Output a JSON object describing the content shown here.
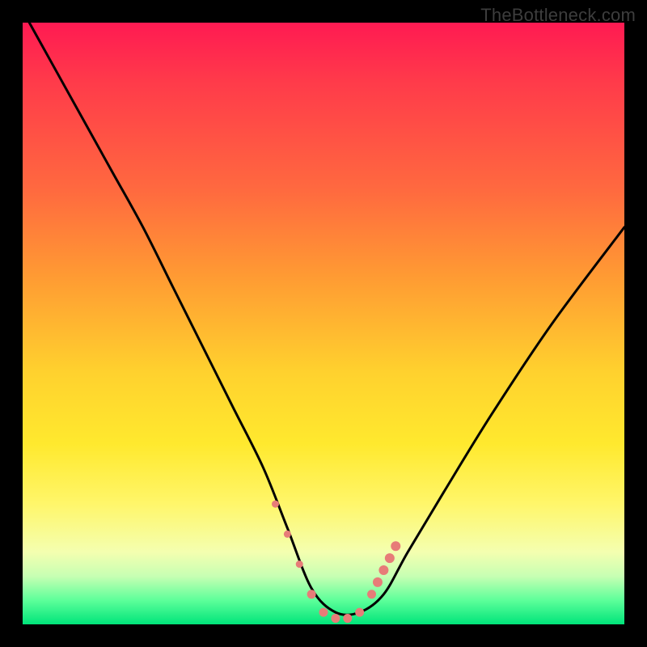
{
  "watermark": "TheBottleneck.com",
  "chart_data": {
    "type": "line",
    "title": "",
    "xlabel": "",
    "ylabel": "",
    "xlim": [
      0,
      100
    ],
    "ylim": [
      0,
      100
    ],
    "series": [
      {
        "name": "bottleneck-curve",
        "x": [
          0,
          5,
          10,
          15,
          20,
          25,
          30,
          35,
          40,
          44,
          48,
          52,
          56,
          60,
          64,
          70,
          78,
          88,
          100
        ],
        "values": [
          102,
          93,
          84,
          75,
          66,
          56,
          46,
          36,
          26,
          16,
          6,
          2,
          2,
          5,
          12,
          22,
          35,
          50,
          66
        ]
      }
    ],
    "markers": {
      "name": "highlight-points",
      "x": [
        42,
        44,
        46,
        48,
        50,
        52,
        54,
        56,
        58,
        59,
        60,
        61,
        62
      ],
      "values": [
        20,
        15,
        10,
        5,
        2,
        1,
        1,
        2,
        5,
        7,
        9,
        11,
        13
      ],
      "radius": [
        4.5,
        4.5,
        4.5,
        5.5,
        5.5,
        5.5,
        5.5,
        5.5,
        5.5,
        6.0,
        6.0,
        6.0,
        6.0
      ]
    },
    "colors": {
      "curve": "#000000",
      "marker": "#e77c78"
    }
  }
}
